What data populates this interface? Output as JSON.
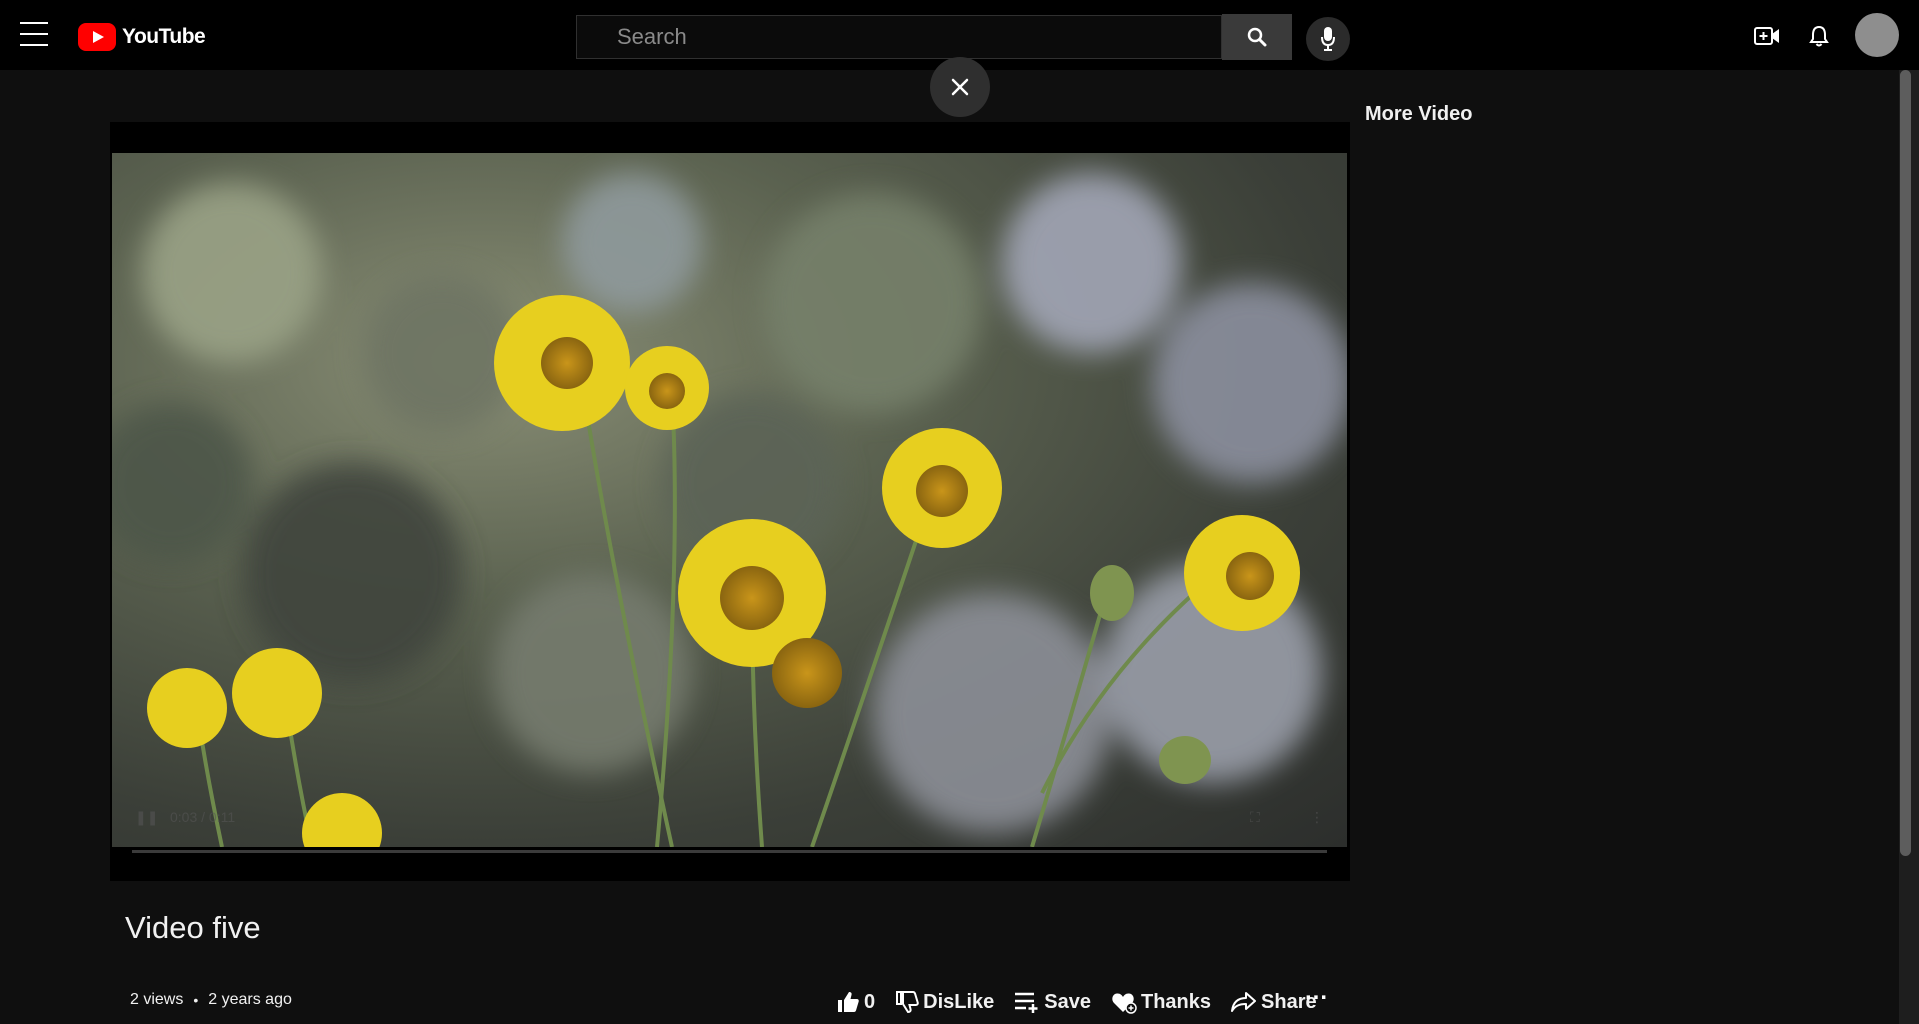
{
  "app": {
    "logo_text": "YouTube"
  },
  "search": {
    "placeholder": "Search"
  },
  "header_icons": [
    "menu-icon",
    "search-icon",
    "mic-icon",
    "create-video-icon",
    "bell-icon",
    "avatar"
  ],
  "player": {
    "time_current": "0:03",
    "time_total": "0:11",
    "time_display": "0:03 / 0:11"
  },
  "sidebar": {
    "title": "More Video"
  },
  "video": {
    "title": "Video five",
    "views": "2 views",
    "age": "2 years ago"
  },
  "actions": {
    "like_count": "0",
    "dislike_label": "DisLike",
    "save_label": "Save",
    "thanks_label": "Thanks",
    "share_label": "Share",
    "more_label": "..."
  },
  "colors": {
    "background": "#0f0f0f",
    "topbar": "#000000",
    "brand_red": "#ff0000",
    "text": "#f1f1f1"
  }
}
